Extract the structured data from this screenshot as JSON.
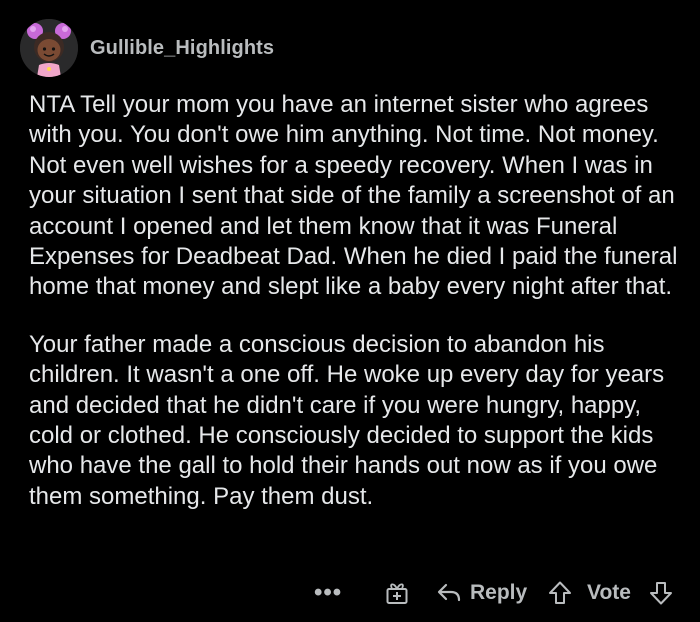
{
  "comment": {
    "username": "Gullible_Highlights",
    "paragraphs": [
      "NTA Tell your mom you have an internet sister who agrees with you. You don't owe him anything. Not time. Not money. Not even well wishes for a speedy recovery. When I was in your situation I sent that side of the family a screenshot of an account I opened and let them know that it was Funeral Expenses for Deadbeat Dad. When he died I paid the funeral home that money and slept like a baby every night after that.",
      "Your father made a conscious decision to abandon his children. It wasn't a one off. He woke up every day for years and decided that he didn't care if you were hungry, happy, cold or clothed. He consciously decided to support the kids who have the gall to hold their hands out now as if you owe them something. Pay them dust."
    ]
  },
  "actions": {
    "more_label": "•••",
    "reply_label": "Reply",
    "vote_label": "Vote"
  },
  "icons": {
    "more": "more-options-icon",
    "award": "award-icon",
    "reply": "reply-arrow-icon",
    "upvote": "upvote-arrow-icon",
    "downvote": "downvote-arrow-icon"
  },
  "colors": {
    "background": "#000000",
    "text": "#e6e8ea",
    "muted": "#b9bcbe",
    "avatar_hair": "#c86ad8"
  }
}
